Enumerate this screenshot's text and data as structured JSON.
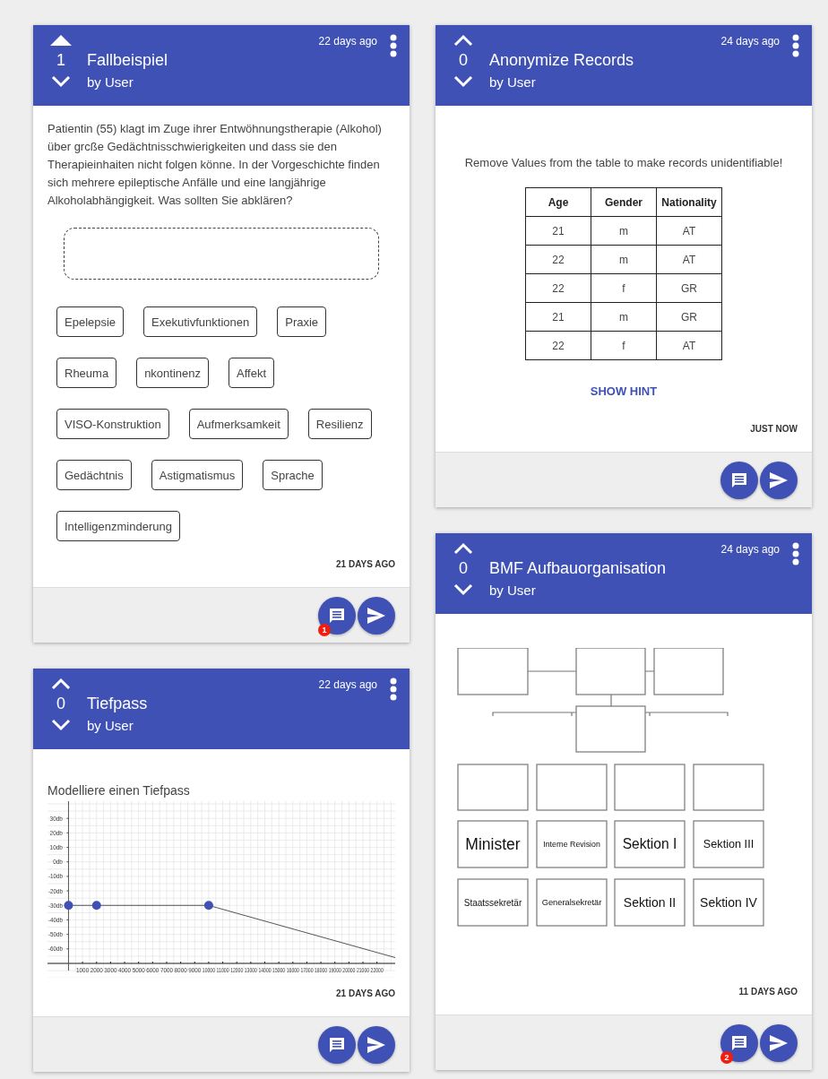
{
  "columns": [
    {
      "cards": [
        {
          "kind": "quiz",
          "votes": "1",
          "upvoted": true,
          "title": "Fallbeispiel",
          "author": "by User",
          "time": "22 days ago",
          "question": "Patientin (55) klagt im Zuge ihrer Entwöhnungstherapie (Alkohol) über grcße Gedächtnisschwierigkeiten und dass sie den Therapieinhaiten nicht folgen könne. In der Vorgeschichte finden sich mehrere epileptische Anfälle und eine langjährige Alkoholabhängigkeit. Was sollten Sie abklären?",
          "chips": [
            "Epelepsie",
            "Exekutivfunktionen",
            "Praxie",
            "Rheuma",
            "nkontinenz",
            "Affekt",
            "VISO-Konstruktion",
            "Aufmerksamkeit",
            "Resilienz",
            "Gedächtnis",
            "Astigmatismus",
            "Sprache",
            "Intelligenzminderung"
          ],
          "footer_time": "21 DAYS AGO",
          "comment_count": "1"
        },
        {
          "kind": "chart",
          "votes": "0",
          "upvoted": false,
          "title": "Tiefpass",
          "author": "by User",
          "time": "22 days ago",
          "prompt": "Modelliere einen Tiefpass",
          "chart_data": {
            "type": "line",
            "x": [
              0,
              2000,
              10000,
              23300
            ],
            "series": [
              {
                "color": "#3f51b5",
                "values": [
                  -30,
                  -30,
                  -30,
                  -66
                ]
              }
            ],
            "xlim": [
              -1500,
              23300
            ],
            "ylim": [
              -70,
              40
            ],
            "grid": true,
            "xticks": [
              1000,
              2000,
              3000,
              4000,
              5000,
              6000,
              7000,
              8000,
              9000,
              10000,
              11000,
              12000,
              13000,
              14000,
              15000,
              16000,
              17000,
              18000,
              19000,
              20000,
              21000,
              22000
            ],
            "yticks": [
              {
                "value": 30,
                "label": "30db"
              },
              {
                "value": 20,
                "label": "20db"
              },
              {
                "value": 10,
                "label": "10db"
              },
              {
                "value": 0,
                "label": "0db"
              },
              {
                "value": -10,
                "label": "-10db"
              },
              {
                "value": -20,
                "label": "-20db"
              },
              {
                "value": -30,
                "label": "-30db"
              },
              {
                "value": -40,
                "label": "-40db"
              },
              {
                "value": -50,
                "label": "-50db"
              },
              {
                "value": -60,
                "label": "-60db"
              }
            ]
          },
          "footer_time": "21 DAYS AGO"
        }
      ]
    },
    {
      "cards": [
        {
          "kind": "table",
          "votes": "0",
          "upvoted": false,
          "title": "Anonymize Records",
          "author": "by User",
          "time": "24 days ago",
          "prompt": "Remove Values from the table to make records unidentifiable!",
          "table": {
            "columns": [
              "Age",
              "Gender",
              "Nationality"
            ],
            "rows": [
              [
                "21",
                "m",
                "AT"
              ],
              [
                "22",
                "m",
                "AT"
              ],
              [
                "22",
                "f",
                "GR"
              ],
              [
                "21",
                "m",
                "GR"
              ],
              [
                "22",
                "f",
                "AT"
              ]
            ]
          },
          "hint_button": "SHOW HINT",
          "footer_time": "JUST NOW"
        },
        {
          "kind": "org",
          "votes": "0",
          "upvoted": false,
          "title": "BMF Aufbauorganisation",
          "author": "by User",
          "time": "24 days ago",
          "org_chart": {
            "rows": [
              [
                "Minister",
                "Interne Revision",
                "Sektion I",
                "Sektion III"
              ],
              [
                "Staatssekretär",
                "Generalsekretär",
                "Sektion II",
                "Sektion IV"
              ]
            ]
          },
          "footer_time": "11 DAYS AGO",
          "comment_count": "2"
        }
      ]
    }
  ]
}
